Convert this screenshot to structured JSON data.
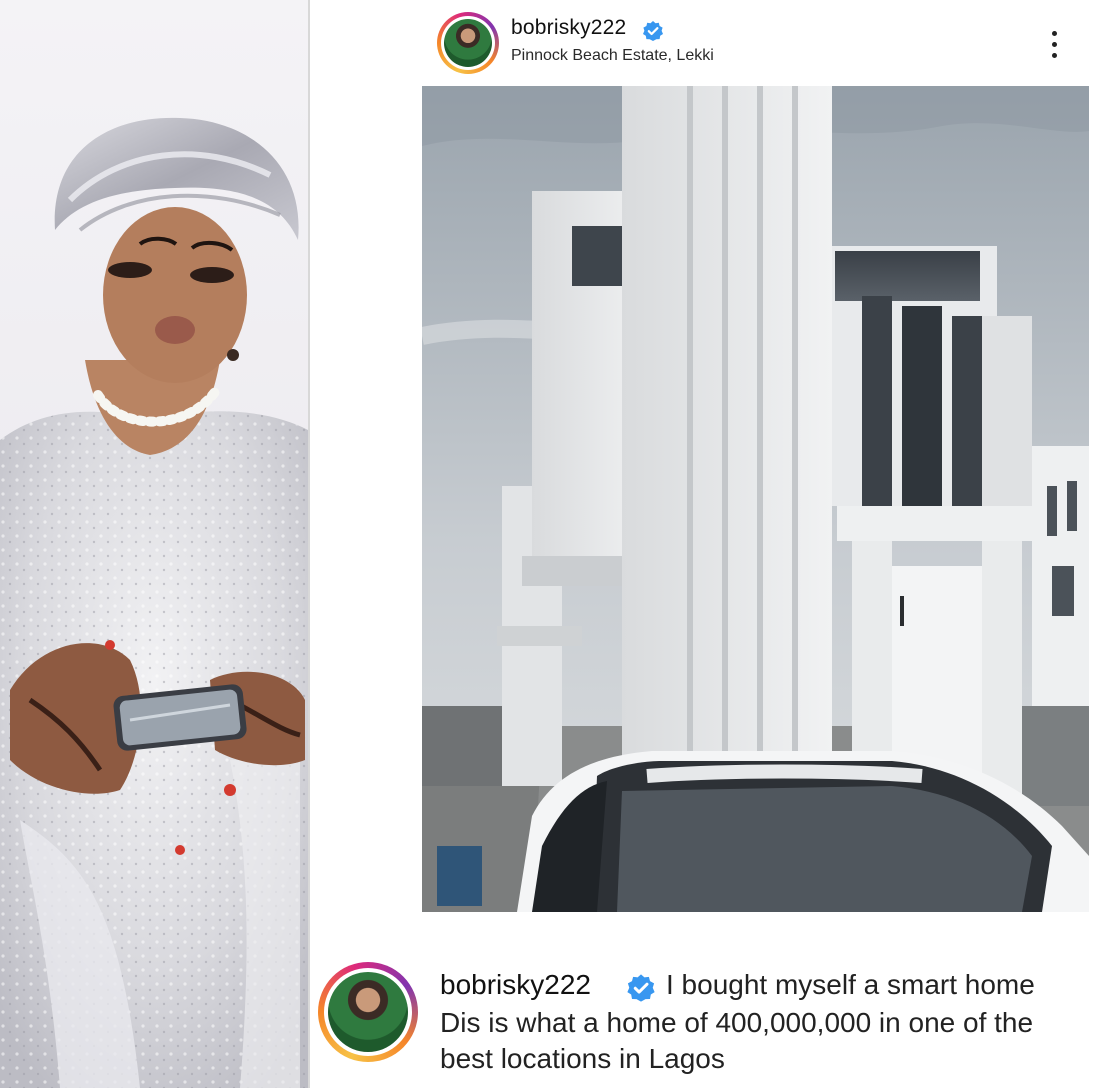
{
  "post": {
    "username": "bobrisky222",
    "verified": true,
    "location": "Pinnock Beach Estate, Lekki",
    "more_icon": "more-vertical-icon"
  },
  "caption": {
    "username": "bobrisky222",
    "line1": "I bought myself a smart home",
    "line2": "Dis is what a home of 400,000,000 in one of the",
    "line3": "best locations in Lagos"
  },
  "colors": {
    "verified_badge": "#3897f0",
    "story_ring": [
      "#f7c246",
      "#f58529",
      "#dd2a7b",
      "#8134af"
    ],
    "text": "#111111"
  }
}
